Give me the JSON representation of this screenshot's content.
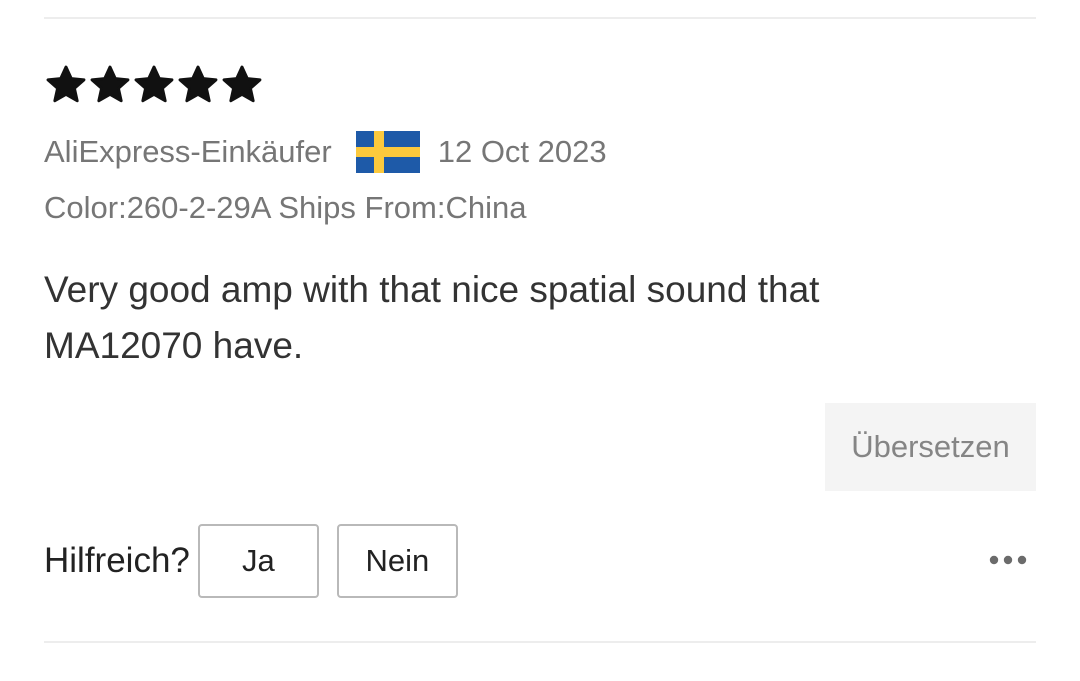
{
  "review": {
    "rating": 5,
    "rating_max": 5,
    "star_color": "#111111",
    "author": "AliExpress-Einkäufer",
    "country_flag": "sweden-flag-icon",
    "date": "12 Oct 2023",
    "sku": "Color:260-2-29A Ships From:China",
    "text": "Very good amp with that nice spatial sound that MA12070 have.",
    "translate_label": "Übersetzen"
  },
  "helpful": {
    "label": "Hilfreich?",
    "yes_label": "Ja",
    "no_label": "Nein"
  },
  "more_icon": "more-horizontal-icon",
  "colors": {
    "text_primary": "#222222",
    "text_secondary": "#767676",
    "divider": "#ededed",
    "button_bg": "#f4f4f4",
    "flag_blue": "#1e5aa8",
    "flag_yellow": "#fcc93d"
  }
}
